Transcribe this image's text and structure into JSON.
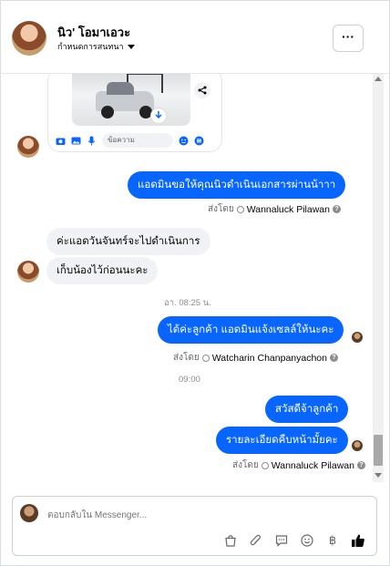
{
  "header": {
    "contact_name": "นิว' โอมาเอวะ",
    "assign_label": "กำหนดการสนทนา",
    "more_label": "···"
  },
  "preview": {
    "input_placeholder": "ข้อความ"
  },
  "messages": [
    {
      "text": "แอดมินขอให้คุณนิวดำเนินเอกสารผ่านน้าาา"
    },
    {
      "text": "ค่ะแอดวันจันทร์จะไปดำเนินการ"
    },
    {
      "text": "เก็บน้องไว้ก่อนนะคะ"
    },
    {
      "text": "ได้ค่ะลูกค้า แอดมินแจ้งเซลล์ให้นะคะ"
    },
    {
      "text": "สวัสดีจ้าลูกค้า"
    },
    {
      "text": "รายละเอียดคืบหน้ามั้ยคะ"
    }
  ],
  "meta": {
    "sent_by": "ส่งโดย",
    "sender_1": "Wannaluck Pilawan",
    "sender_2": "Watcharin Chanpanyachon",
    "sender_3": "Wannaluck Pilawan",
    "question_mark": "?"
  },
  "timestamps": {
    "t1": "อา. 08:25 น.",
    "t2": "09:00"
  },
  "composer": {
    "placeholder": "ตอบกลับใน Messenger..."
  },
  "colors": {
    "outgoing_bubble": "#0866ff",
    "incoming_bubble": "#f0f2f5",
    "like_icon": "#050505"
  },
  "icons": {
    "tool_1": "bag-icon",
    "tool_2": "paperclip-icon",
    "tool_3": "saved-reply-icon",
    "tool_4": "emoji-icon",
    "tool_5": "baht-icon",
    "tool_6": "thumbs-up-icon"
  },
  "tool_symbols": {
    "baht": "฿"
  }
}
